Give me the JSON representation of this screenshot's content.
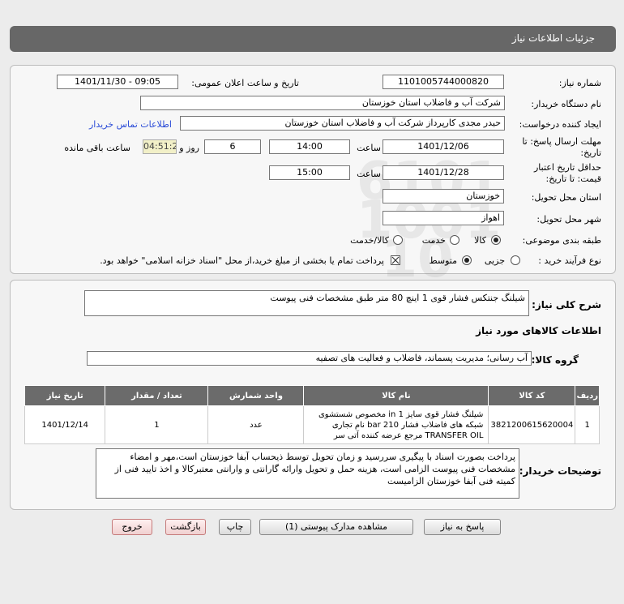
{
  "header": {
    "title": "جزئیات اطلاعات نیاز"
  },
  "fields": {
    "need_number_label": "شماره نیاز:",
    "need_number": "1101005744000820",
    "announce_label": "تاریخ و ساعت اعلان عمومی:",
    "announce_value": "1401/11/30 - 09:05",
    "buyer_org_label": "نام دستگاه خریدار:",
    "buyer_org": "شرکت آب و فاضلاب استان خوزستان",
    "creator_label": "ایجاد کننده درخواست:",
    "creator": "حیدر مجدی کارپرداز شرکت آب و فاضلاب استان خوزستان",
    "contact_link": "اطلاعات تماس خریدار",
    "deadline_label_1": "مهلت ارسال پاسخ: تا",
    "deadline_label_2": "تاریخ:",
    "deadline_date": "1401/12/06",
    "hour_label": "ساعت",
    "deadline_time": "14:00",
    "day_count": "6",
    "day_label": "روز و",
    "remaining_time": "04:51:28",
    "remaining_label": "ساعت باقی مانده",
    "validity_label_1": "حداقل تاریخ اعتبار",
    "validity_label_2": "قیمت: تا تاریخ:",
    "validity_date": "1401/12/28",
    "validity_time": "15:00",
    "province_label": "استان محل تحویل:",
    "province": "خوزستان",
    "city_label": "شهر محل تحویل:",
    "city": "اهواز",
    "category_label": "طبقه بندی موضوعی:",
    "category_options": [
      "کالا",
      "خدمت",
      "کالا/خدمت"
    ],
    "process_label": "نوع فرآیند خرید :",
    "process_options": [
      "جزیی",
      "متوسط"
    ],
    "payment_note": "پرداخت تمام یا بخشی از مبلغ خرید،از محل \"اسناد خزانه اسلامی\" خواهد بود."
  },
  "summary": {
    "label": "شرح کلی نیاز:",
    "text": "شیلنگ جنتکس فشار قوی 1 اینچ 80 متر طبق مشخصات فنی پیوست"
  },
  "goods": {
    "section_title": "اطلاعات کالاهای مورد نیاز",
    "group_label": "گروه کالا:",
    "group_value": "آب رسانی؛ مدیریت پسماند، فاضلاب و فعالیت های تصفیه",
    "columns": [
      "ردیف",
      "کد کالا",
      "نام کالا",
      "واحد شمارش",
      "تعداد / مقدار",
      "تاریخ نیاز"
    ],
    "rows": [
      {
        "row": "1",
        "code": "3821200615620004",
        "name": "شیلنگ فشار قوی سایز 1 in مخصوص شستشوی شبکه های فاضلاب فشار 210 bar نام تجاری TRANSFER OIL مرجع عرضه کننده آتی سر",
        "unit": "عدد",
        "qty": "1",
        "date": "1401/12/14"
      }
    ]
  },
  "buyer_notes": {
    "label": "توضیحات خریدار:",
    "text": "پرداخت بصورت اسناد با پیگیری  سررسید و زمان تحویل توسط ذیحساب آبفا خوزستان است،مهر و امضاء مشخصات فنی پیوست الزامی است، هزینه حمل و تحویل وارائه گارانتی و وارانتی معتبرکالا و اخذ تایید فنی از کمیته فنی آبفا خوزستان الزامیست"
  },
  "buttons": {
    "reply": "پاسخ به نیاز",
    "view_docs": "مشاهده مدارک پیوستی (1)",
    "print": "چاپ",
    "back": "بازگشت",
    "exit": "خروج"
  },
  "watermark": {
    "brand": "ParsNamadData"
  },
  "colors": {
    "header": "#676767",
    "link": "#2a4bd7",
    "table_header": "#6b6b6b",
    "remaining_bg": "#f2f0c8"
  }
}
